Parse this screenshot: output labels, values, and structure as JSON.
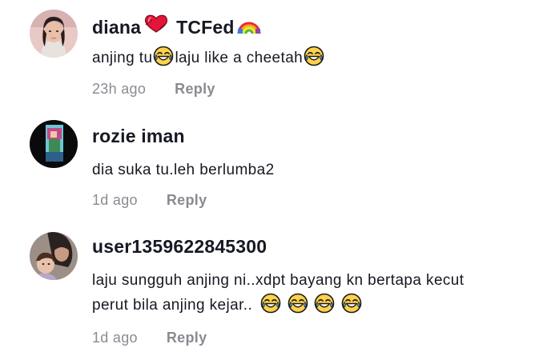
{
  "comments": [
    {
      "username_a": "diana",
      "username_b": "TCFed",
      "text_parts": [
        "anjing tu",
        "laju like a cheetah"
      ],
      "time": "23h ago",
      "reply_label": "Reply"
    },
    {
      "username": "rozie iman",
      "text": "dia suka tu.leh berlumba2",
      "time": "1d ago",
      "reply_label": "Reply"
    },
    {
      "username": "user1359622845300",
      "text_line1": "laju sungguh anjing ni..xdpt bayang kn bertapa kecut",
      "text_line2": "perut bila anjing kejar..",
      "time": "1d ago",
      "reply_label": "Reply"
    }
  ],
  "icons": {
    "laugh": "face-with-tears-of-joy-icon",
    "heart": "red-heart-icon",
    "rainbow": "rainbow-icon"
  }
}
